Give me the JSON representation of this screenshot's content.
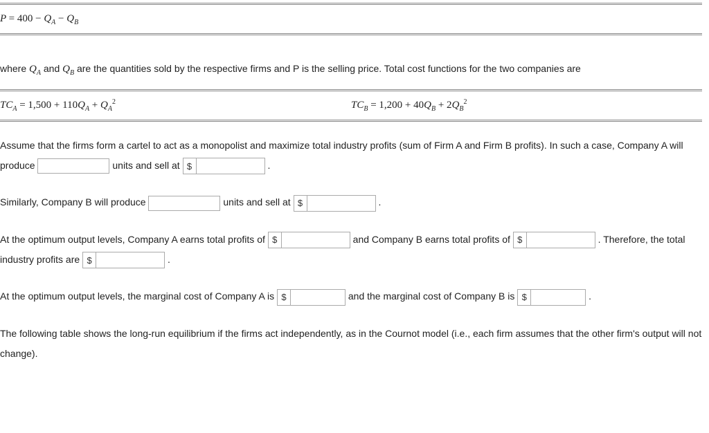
{
  "equations": {
    "demand_text": "P = 400 − Q_A − Q_B",
    "demand": {
      "const": 400,
      "qa_coef": -1,
      "qb_coef": -1
    },
    "tca_text": "TC_A = 1,500 + 110Q_A + Q_A^2",
    "tca": {
      "fixed": 1500,
      "lin_coef": 110,
      "quad_coef": 1
    },
    "tcb_text": "TC_B = 1,200 + 40Q_B + 2Q_B^2",
    "tcb": {
      "fixed": 1200,
      "lin_coef": 40,
      "quad_coef": 2
    }
  },
  "text": {
    "where_line": "where Q_A and Q_B are the quantities sold by the respective firms and P is the selling price. Total cost functions for the two companies are",
    "where_pre": "where ",
    "where_and": " and ",
    "where_post": " are the quantities sold by the respective firms and P is the selling price. Total cost functions for the two companies are",
    "assume_pre": "Assume that the firms form a cartel to act as a monopolist and maximize total industry profits (sum of Firm A and Firm B profits). In such a case, Company A will produce ",
    "units_sell": " units and sell at ",
    "period": " .",
    "similarly": "Similarly, Company B will produce ",
    "profits_pre": "At the optimum output levels, Company A earns total profits of ",
    "profits_mid": " and Company B earns total profits of ",
    "therefore": " . Therefore, the total industry profits are ",
    "mc_pre": "At the optimum output levels, the marginal cost of Company A is ",
    "mc_mid": " and the marginal cost of Company B is ",
    "table_intro": "The following table shows the long-run equilibrium if the firms act independently, as in the Cournot model (i.e., each firm assumes that the other firm's output will not change)."
  },
  "currency": "$",
  "inputs": {
    "qa_units": "",
    "pa_price": "",
    "qb_units": "",
    "pb_price": "",
    "profit_a": "",
    "profit_b": "",
    "profit_total": "",
    "mc_a": "",
    "mc_b": ""
  }
}
